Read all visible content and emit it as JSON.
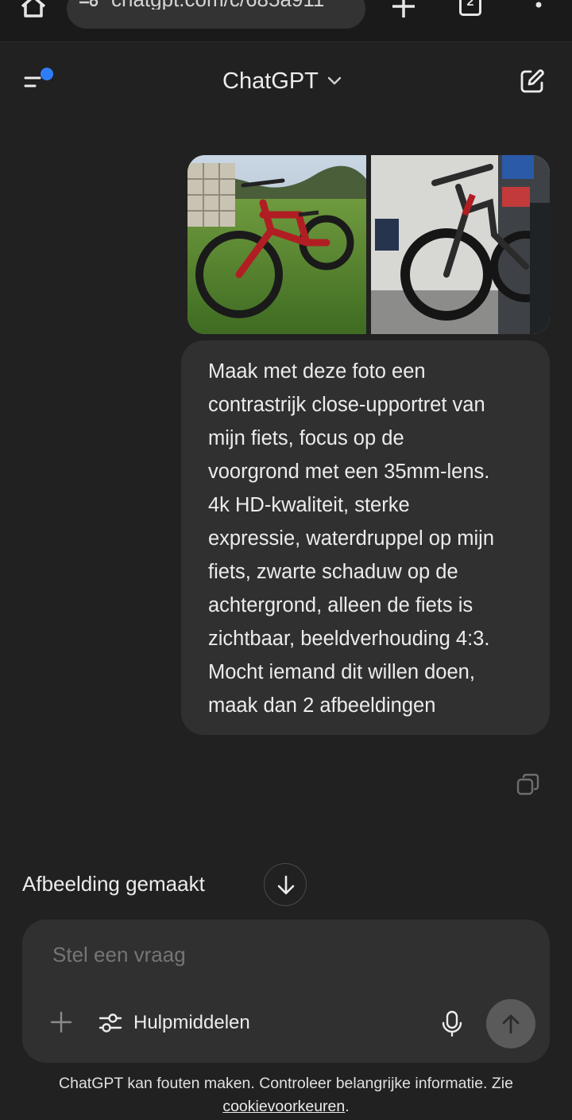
{
  "browser": {
    "url": "chatgpt.com/c/685a911",
    "tab_count": "2"
  },
  "header": {
    "title": "ChatGPT"
  },
  "conversation": {
    "user_message": "Maak met deze foto een\ncontrastrijk close-upportret van\nmijn fiets, focus op de\nvoorgrond met een 35mm-lens.\n4k HD-kwaliteit, sterke\nexpressie, waterdruppel op mijn\nfiets, zwarte schaduw op de\nachtergrond, alleen de fiets is\nzichtbaar, beeldverhouding 4:3.\nMocht iemand dit willen doen,\nmaak dan 2 afbeeldingen",
    "status": "Afbeelding gemaakt"
  },
  "composer": {
    "placeholder": "Stel een vraag",
    "tools_label": "Hulpmiddelen"
  },
  "footer": {
    "disclaimer": "ChatGPT kan fouten maken. Controleer belangrijke informatie. Zie",
    "link": "cookievoorkeuren",
    "suffix": "."
  },
  "colors": {
    "background": "#212121",
    "bubble": "#303030",
    "accent_dot": "#2f7df6"
  },
  "icons": [
    "home-icon",
    "site-settings-icon",
    "plus-icon",
    "tabs-icon",
    "more-icon",
    "menu-icon",
    "chevron-down-icon",
    "edit-icon",
    "copy-icon",
    "arrow-down-icon",
    "attach-icon",
    "sliders-icon",
    "mic-icon",
    "arrow-up-icon"
  ]
}
